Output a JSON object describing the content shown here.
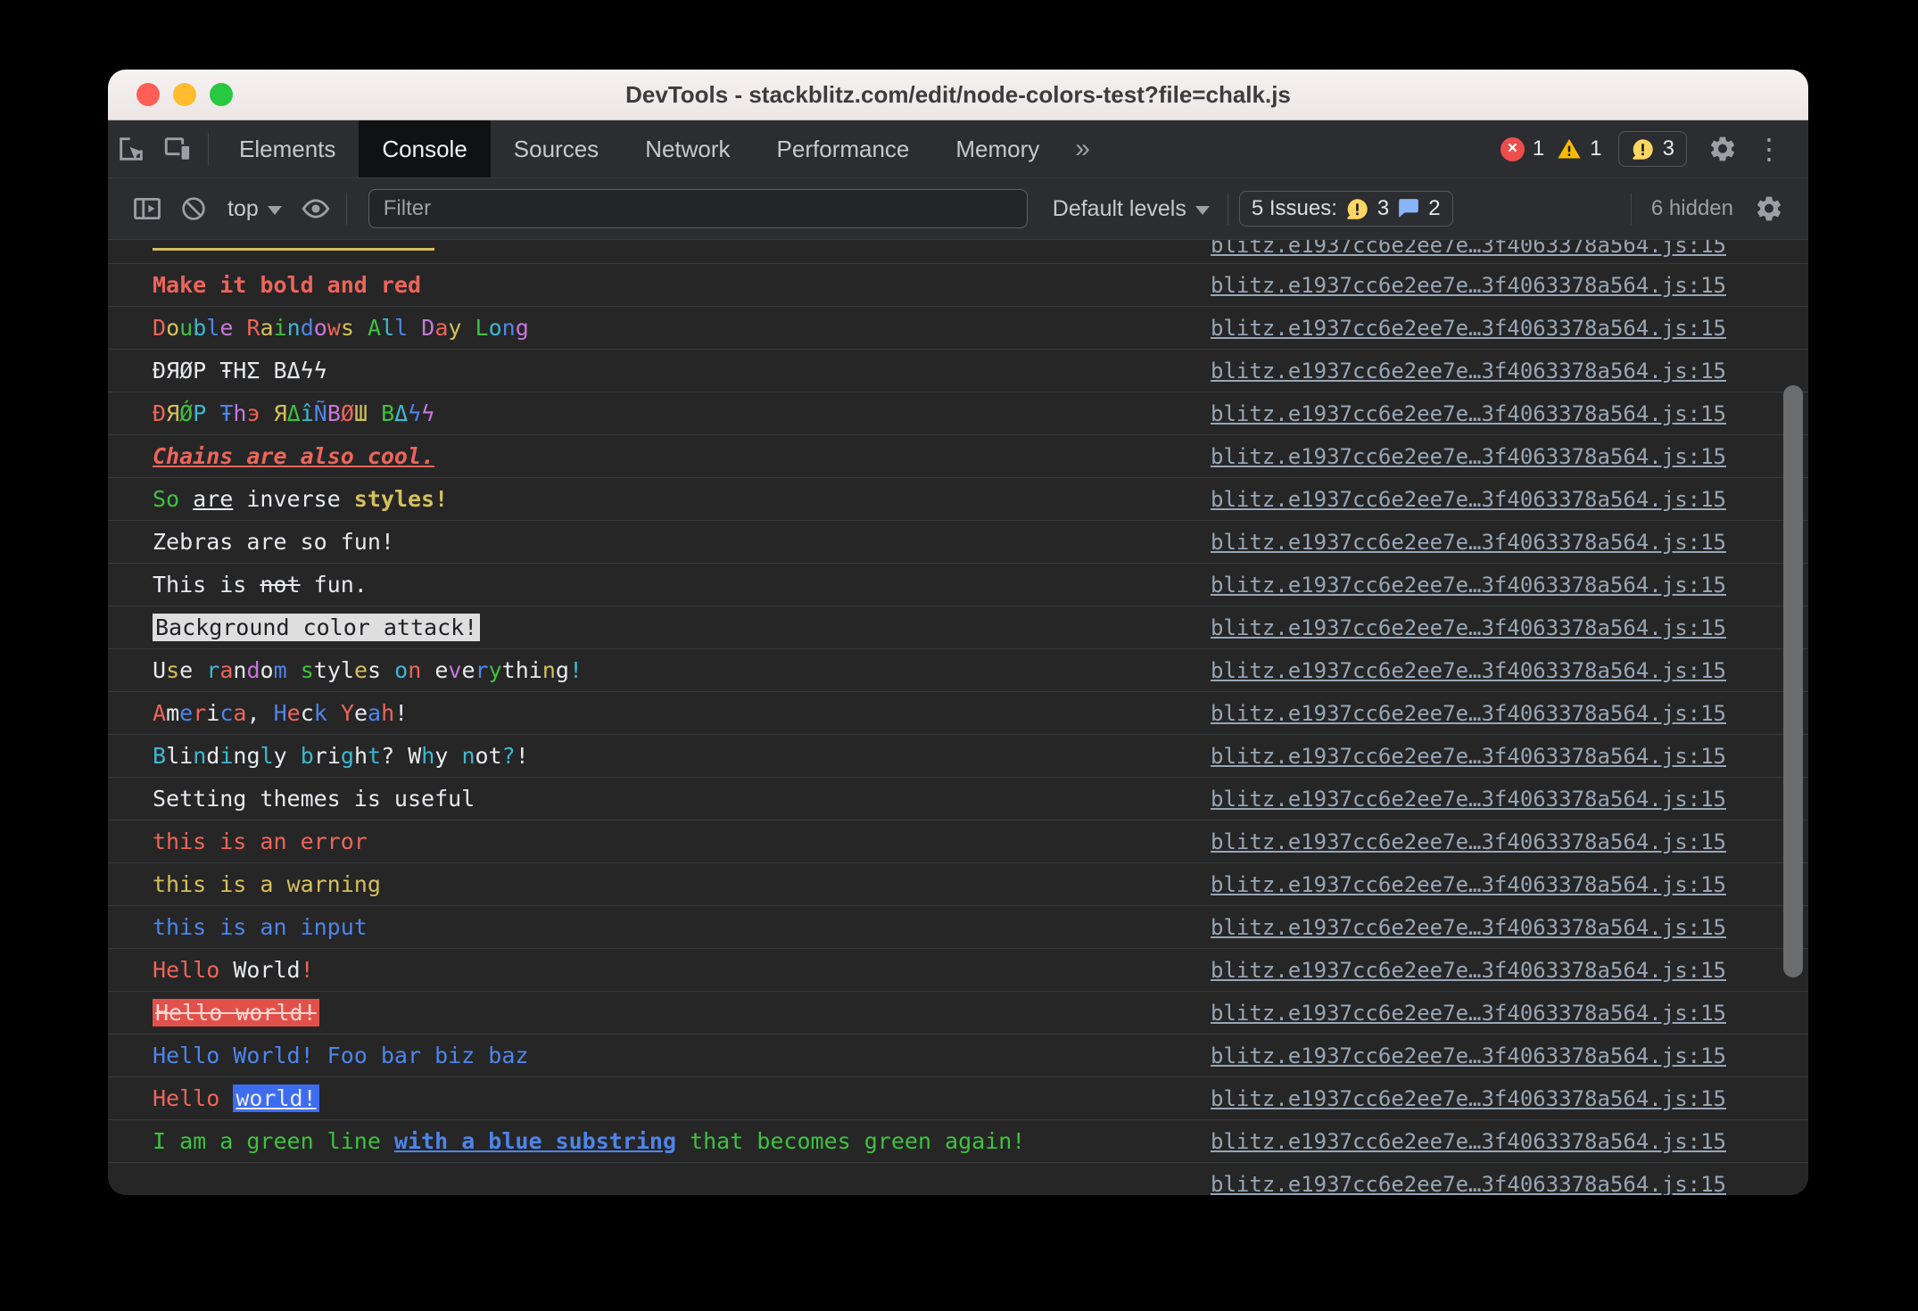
{
  "window": {
    "title": "DevTools - stackblitz.com/edit/node-colors-test?file=chalk.js"
  },
  "icons": {
    "more_tabs": "»",
    "kebab_menu": "⋮",
    "close_glyph": "×"
  },
  "main_toolbar": {
    "tabs": [
      {
        "label": "Elements"
      },
      {
        "label": "Console"
      },
      {
        "label": "Sources"
      },
      {
        "label": "Network"
      },
      {
        "label": "Performance"
      },
      {
        "label": "Memory"
      }
    ],
    "error_count": "1",
    "warning_count": "1",
    "issues_count": "3"
  },
  "console_toolbar": {
    "context_label": "top",
    "filter_placeholder": "Filter",
    "levels_label": "Default levels",
    "issues_summary": "5 Issues:",
    "issues_yellow_count": "3",
    "issues_blue_count": "2",
    "hidden_label": "6 hidden"
  },
  "palette": {
    "red": "#ed655a",
    "green": "#3ec23e",
    "yellow": "#d4c05a",
    "blue": "#4e85e9",
    "cyan": "#3cb8d0",
    "magenta": "#c678dd",
    "white": "#e8eaed",
    "dark": "#202124",
    "light_bg": "#dedede",
    "red_bg": "#e2504a",
    "blue_bg": "#3d6cf0",
    "pink": "#ffd7d2"
  },
  "console": {
    "source_link": "blitz.e1937cc6e2ee7e…3f4063378a564.js:15",
    "rows": [
      {
        "type": "partial-top"
      },
      {
        "segments": [
          {
            "t": "Make it bold and red",
            "c": "red",
            "b": true
          }
        ]
      },
      {
        "segments": [
          {
            "t": "Double Raindows All Day Long",
            "perLetter": true,
            "cycle": [
              "red",
              "yellow",
              "green",
              "cyan",
              "blue",
              "magenta"
            ]
          }
        ]
      },
      {
        "segments": [
          {
            "t": "ĐЯØP ŦHΣ ВΔϟϟ",
            "c": "white"
          }
        ]
      },
      {
        "segments": [
          {
            "t": "ĐЯǾP Ŧhэ ЯΔîÑВØШ ВΔϟϟ",
            "perLetter": true,
            "cycle": [
              "red",
              "yellow",
              "green",
              "cyan",
              "blue",
              "magenta"
            ]
          }
        ]
      },
      {
        "segments": [
          {
            "t": "Chains are also cool.",
            "c": "red",
            "b": true,
            "i": true,
            "u": true
          }
        ]
      },
      {
        "segments": [
          {
            "t": "So",
            "c": "green"
          },
          {
            "t": " ",
            "c": "white"
          },
          {
            "t": "are",
            "c": "white",
            "u": true
          },
          {
            "t": " inverse ",
            "c": "white"
          },
          {
            "t": "styles!",
            "c": "yellow",
            "b": true
          }
        ]
      },
      {
        "segments": [
          {
            "t": "Zebras are so fun!",
            "c": "white"
          }
        ]
      },
      {
        "segments": [
          {
            "t": "This is ",
            "c": "white"
          },
          {
            "t": "not",
            "c": "white",
            "s": true
          },
          {
            "t": " fun.",
            "c": "white"
          }
        ]
      },
      {
        "segments": [
          {
            "t": "Background color attack!",
            "c": "dark",
            "bg": "light_bg"
          }
        ]
      },
      {
        "segments": [
          {
            "t": "Use random styles on everything!",
            "perLetter": true,
            "cycle": [
              "white",
              "yellow",
              "white",
              "cyan",
              "red",
              "white",
              "magenta",
              "white",
              "blue",
              "green",
              "white",
              "white"
            ]
          }
        ]
      },
      {
        "segments": [
          {
            "t": "America, Heck Yeah!",
            "perLetter": true,
            "cycle": [
              "red",
              "white",
              "blue"
            ]
          }
        ]
      },
      {
        "segments": [
          {
            "t": "Blindingly bright? Why not?!",
            "perLetter": true,
            "cycle": [
              "cyan",
              "white",
              "white",
              "cyan",
              "white"
            ]
          }
        ]
      },
      {
        "segments": [
          {
            "t": "Setting themes is useful",
            "c": "white"
          }
        ]
      },
      {
        "segments": [
          {
            "t": "this is an error",
            "c": "red"
          }
        ]
      },
      {
        "segments": [
          {
            "t": "this is a warning",
            "c": "yellow"
          }
        ]
      },
      {
        "segments": [
          {
            "t": "this is an input",
            "c": "blue"
          }
        ]
      },
      {
        "segments": [
          {
            "t": "Hello",
            "c": "red"
          },
          {
            "t": " World",
            "c": "white"
          },
          {
            "t": "!",
            "c": "red"
          }
        ]
      },
      {
        "segments": [
          {
            "t": "Hello world!",
            "c": "pink",
            "bg": "red_bg",
            "s": true
          }
        ]
      },
      {
        "segments": [
          {
            "t": "Hello World! Foo bar biz baz",
            "c": "blue"
          }
        ]
      },
      {
        "segments": [
          {
            "t": "Hello ",
            "c": "red"
          },
          {
            "t": "world!",
            "c": "white",
            "bg": "blue_bg",
            "u": true
          }
        ]
      },
      {
        "segments": [
          {
            "t": "I am a green line ",
            "c": "green"
          },
          {
            "t": "with a blue substring",
            "c": "blue",
            "b": true,
            "u": true
          },
          {
            "t": " that becomes green again!",
            "c": "green"
          }
        ]
      },
      {
        "type": "link-only"
      }
    ]
  }
}
